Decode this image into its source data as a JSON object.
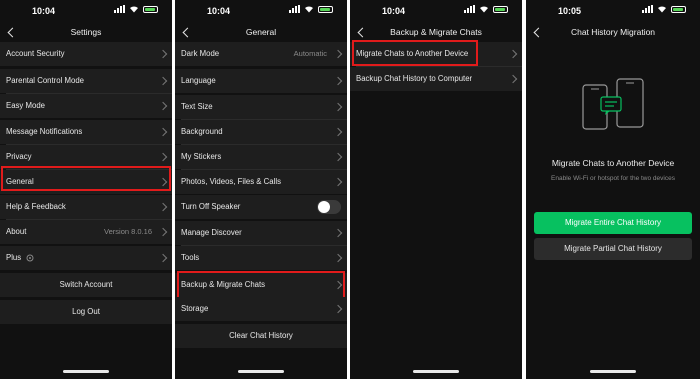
{
  "colors": {
    "accent_green": "#07c160",
    "highlight_red": "#e11b1b",
    "bg": "#111111",
    "row_bg": "#1e1e1e"
  },
  "panel1": {
    "time": "10:04",
    "title": "Settings",
    "items": [
      {
        "label": "Account Security"
      },
      {
        "label": "Parental Control Mode"
      },
      {
        "label": "Easy Mode"
      },
      {
        "label": "Message Notifications"
      },
      {
        "label": "Privacy"
      },
      {
        "label": "General"
      },
      {
        "label": "Help & Feedback"
      },
      {
        "label": "About",
        "value": "Version 8.0.16"
      },
      {
        "label": "Plus"
      }
    ],
    "switch_account": "Switch Account",
    "log_out": "Log Out"
  },
  "panel2": {
    "time": "10:04",
    "title": "General",
    "items": [
      {
        "label": "Dark Mode",
        "value": "Automatic"
      },
      {
        "label": "Language"
      },
      {
        "label": "Text Size"
      },
      {
        "label": "Background"
      },
      {
        "label": "My Stickers"
      },
      {
        "label": "Photos, Videos, Files & Calls"
      },
      {
        "label": "Turn Off Speaker"
      },
      {
        "label": "Manage Discover"
      },
      {
        "label": "Tools"
      },
      {
        "label": "Backup & Migrate Chats"
      },
      {
        "label": "Storage"
      }
    ],
    "clear_history": "Clear Chat History"
  },
  "panel3": {
    "time": "10:04",
    "title": "Backup & Migrate Chats",
    "items": [
      {
        "label": "Migrate Chats to Another Device"
      },
      {
        "label": "Backup Chat History to Computer"
      }
    ]
  },
  "panel4": {
    "time": "10:05",
    "title": "Chat History Migration",
    "heading": "Migrate Chats to Another Device",
    "subtext": "Enable Wi-Fi or hotspot for the two devices",
    "primary_button": "Migrate Entire Chat History",
    "secondary_button": "Migrate Partial Chat History"
  }
}
